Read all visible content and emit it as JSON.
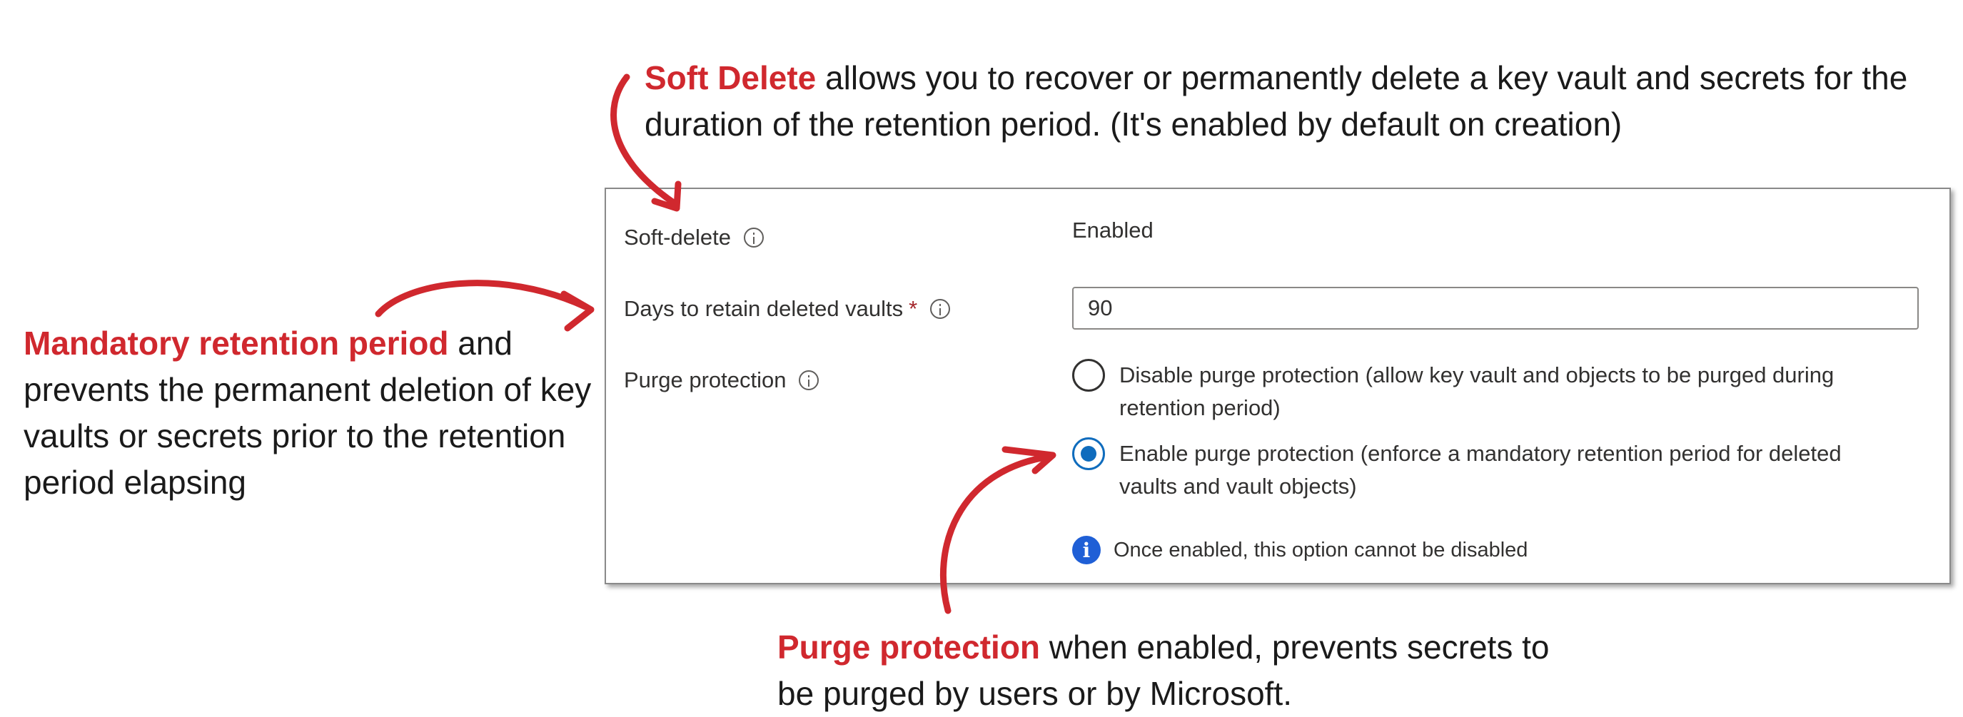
{
  "callouts": {
    "soft_delete": {
      "highlight": "Soft Delete",
      "text": " allows you to recover or permanently delete a key vault and secrets for the duration of the retention period. (It's enabled by default on creation)"
    },
    "mandatory": {
      "highlight": "Mandatory retention period",
      "text": " and prevents the permanent deletion of key vaults or secrets prior to the retention period elapsing"
    },
    "purge": {
      "highlight": "Purge protection",
      "text": " when enabled, prevents secrets to be purged by users or by Microsoft."
    }
  },
  "form": {
    "soft_delete": {
      "label": "Soft-delete",
      "value": "Enabled"
    },
    "retention_days": {
      "label": "Days to retain deleted vaults",
      "required_mark": "*",
      "value": "90"
    },
    "purge_protection": {
      "label": "Purge protection",
      "options": [
        {
          "label": "Disable purge protection (allow key vault and objects to be purged during retention period)",
          "selected": false
        },
        {
          "label": "Enable purge protection (enforce a mandatory retention period for deleted vaults and vault objects)",
          "selected": true
        }
      ],
      "note": "Once enabled, this option cannot be disabled"
    }
  },
  "icons": {
    "info_outline": "info-icon",
    "info_solid": "info-circle-icon",
    "arrow": "hand-drawn-arrow"
  },
  "colors": {
    "highlight": "#d0282e",
    "accent": "#0f6cbd",
    "info": "#1f5fd6",
    "required": "#a4262c"
  }
}
